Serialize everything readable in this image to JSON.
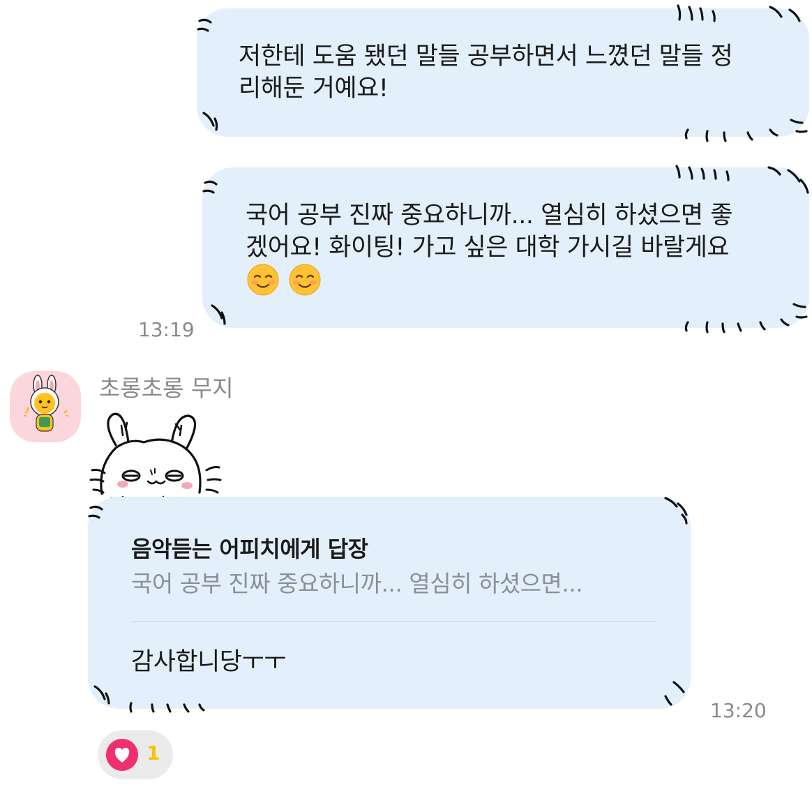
{
  "messages": [
    {
      "text": "저한테 도움 됐던 말들 공부하면서 느꼈던 말들 정\n리해둔 거예요!"
    },
    {
      "text": "국어 공부 진짜 중요하니까... 열심히 하셨으면 좋\n겠어요! 화이팅! 가고 싶은 대학 가시길 바랄게요",
      "time": "13:19",
      "emojis": [
        "smiling-face-icon",
        "smiling-face-icon"
      ]
    }
  ],
  "sender": {
    "name": "초롱초롱 무지",
    "avatar": "apeach-avatar-icon"
  },
  "reply": {
    "title": "음악듣는 어피치에게 답장",
    "preview": "국어 공부 진짜 중요하니까... 열심히 하셨으면...",
    "body": "감사합니당ㅜㅜ",
    "time": "13:20"
  },
  "reaction": {
    "icon": "heart-icon",
    "count": "1",
    "color": "#f0306e",
    "count_color": "#f5c400"
  },
  "colors": {
    "bubble": "#e3f0fb",
    "time": "#8a8a8a",
    "background": "#ffffff"
  }
}
